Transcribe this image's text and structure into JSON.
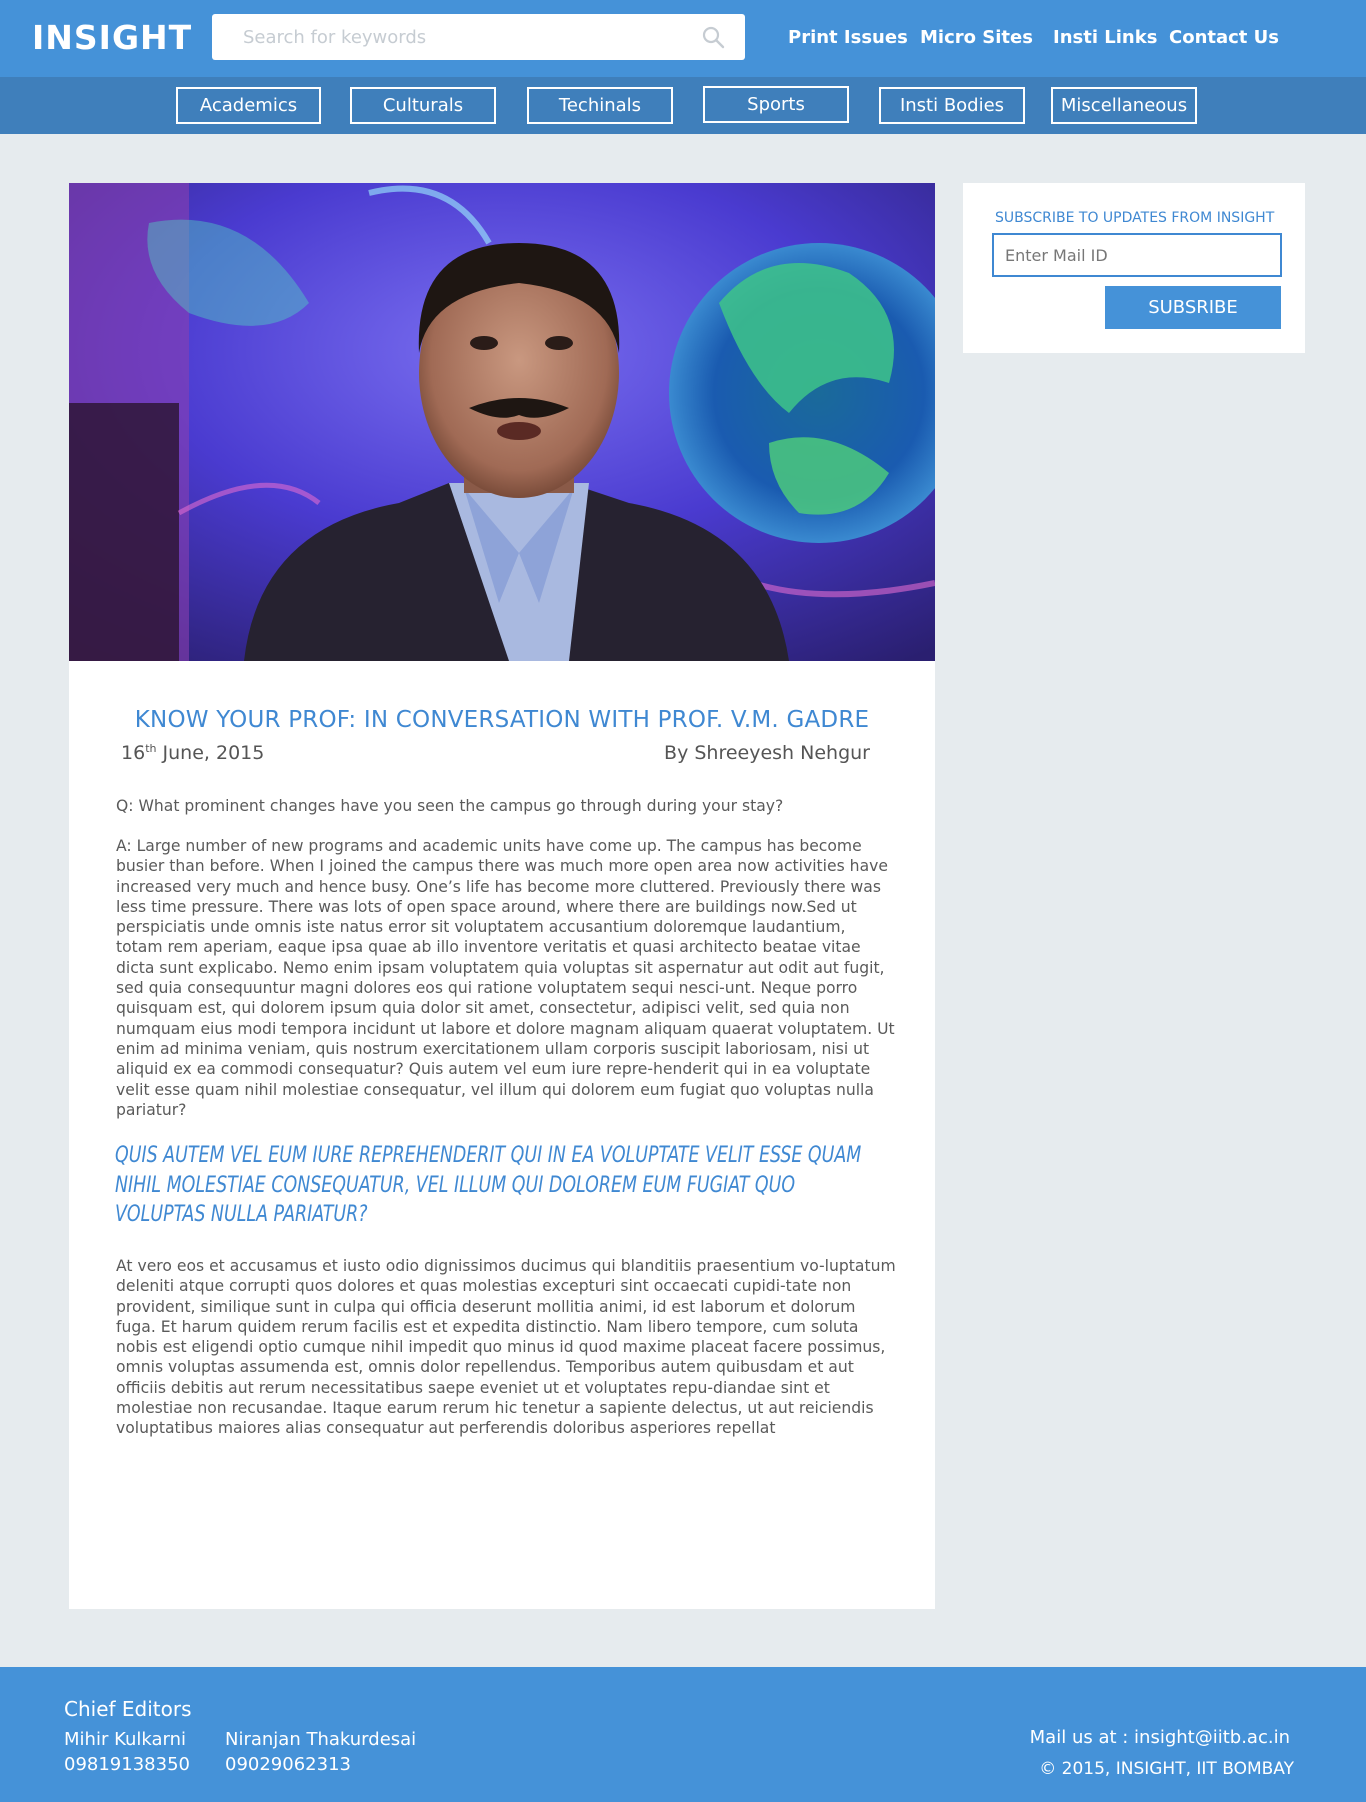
{
  "header": {
    "logo": "INSIGHT",
    "search_placeholder": "Search for keywords",
    "nav": [
      "Print Issues",
      "Micro Sites",
      "Insti Links",
      "Contact Us"
    ]
  },
  "categories": [
    "Academics",
    "Culturals",
    "Techinals",
    "Sports",
    "Insti Bodies",
    "Miscellaneous"
  ],
  "article": {
    "title": "KNOW YOUR PROF: IN CONVERSATION WITH PROF. V.M. GADRE",
    "date_day": "16",
    "date_suffix": "th",
    "date_rest": " June, 2015",
    "author": "By Shreeyesh Nehgur",
    "question": "Q: What prominent changes have you seen the campus go through during your stay?",
    "answer": "A: Large number of new programs and academic units have come up. The campus has become busier than before. When I joined the campus there was much more open area now activities have increased very much and hence busy. One’s life has become more cluttered. Previously there was less time pressure. There was lots of open space around, where there are buildings now.Sed ut perspiciatis unde omnis iste natus error sit voluptatem accusantium doloremque laudantium, totam rem aperiam, eaque ipsa quae ab illo inventore veritatis et quasi architecto beatae vitae dicta sunt explicabo. Nemo enim ipsam voluptatem quia voluptas sit aspernatur aut odit aut fugit, sed quia consequuntur magni dolores eos qui ratione voluptatem sequi nesci-unt. Neque porro quisquam est, qui dolorem ipsum quia dolor sit amet, consectetur, adipisci velit, sed quia non numquam eius modi tempora incidunt ut labore et dolore magnam aliquam quaerat voluptatem. Ut enim ad minima veniam, quis nostrum exercitationem ullam corporis suscipit laboriosam, nisi ut aliquid ex ea commodi consequatur? Quis autem vel eum iure repre-henderit qui in ea voluptate velit esse quam nihil molestiae consequatur, vel illum qui dolorem eum fugiat quo voluptas nulla pariatur?",
    "pullquote": "Quis autem vel eum iure reprehenderit qui in ea voluptate velit esse quam nihil molestiae consequatur, vel illum qui dolorem eum fugiat quo voluptas nulla pariatur?",
    "closing": "At vero eos et accusamus et iusto odio dignissimos ducimus qui blanditiis praesentium vo-luptatum deleniti atque corrupti quos dolores et quas molestias excepturi sint occaecati cupidi-tate non provident, similique sunt in culpa qui officia deserunt mollitia animi, id est laborum et dolorum fuga. Et harum quidem rerum facilis est et expedita distinctio. Nam libero tempore, cum soluta nobis est eligendi optio cumque nihil impedit quo minus id quod maxime placeat facere possimus, omnis voluptas assumenda est, omnis dolor repellendus. Temporibus autem quibusdam et aut officiis debitis aut rerum necessitatibus saepe eveniet ut et voluptates repu-diandae sint et molestiae non recusandae. Itaque earum rerum hic tenetur a sapiente delectus, ut aut reiciendis voluptatibus maiores alias consequatur aut perferendis doloribus asperiores repellat"
  },
  "sidebar": {
    "heading": "SUBSCRIBE TO UPDATES FROM INSIGHT",
    "email_placeholder": "Enter Mail ID",
    "button": "SUBSRIBE"
  },
  "footer": {
    "heading": "Chief Editors",
    "editors": [
      {
        "name": "Mihir Kulkarni",
        "phone": "09819138350"
      },
      {
        "name": "Niranjan Thakurdesai",
        "phone": "09029062313"
      }
    ],
    "mail": "Mail us at : insight@iitb.ac.in",
    "copyright": "© 2015, INSIGHT, IIT BOMBAY"
  },
  "colors": {
    "brand_blue": "#4592d8",
    "category_bar": "#3f7fbb",
    "accent_text": "#3f88d2",
    "page_bg": "#e6ebee"
  },
  "icons": [
    "search-icon"
  ]
}
